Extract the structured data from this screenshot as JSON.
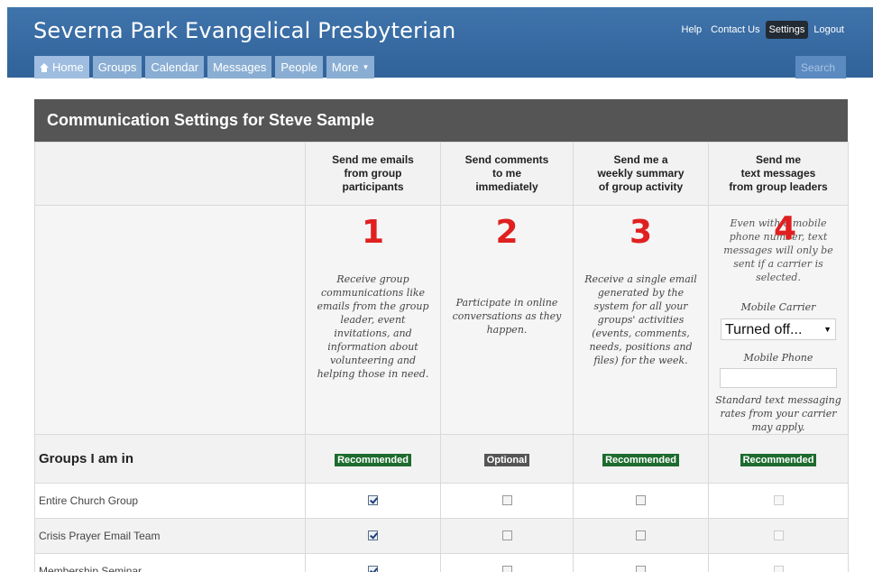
{
  "header": {
    "site_title": "Severna Park Evangelical Presbyterian",
    "utility_links": [
      "Help",
      "Contact Us",
      "Settings",
      "Logout"
    ],
    "active_utility": "Settings",
    "nav": [
      "Home",
      "Groups",
      "Calendar",
      "Messages",
      "People",
      "More"
    ],
    "search_placeholder": "Search"
  },
  "panel": {
    "title": "Communication Settings for Steve Sample",
    "columns": [
      {
        "header": [
          "Send me emails",
          "from group",
          "participants"
        ],
        "number": "1",
        "description": "Receive group communications like emails from the group leader, event invitations, and information about volunteering and helping those in need.",
        "badge": "Recommended"
      },
      {
        "header": [
          "Send comments",
          "to me",
          "immediately"
        ],
        "number": "2",
        "description": "Participate in online conversations as they happen.",
        "badge": "Optional"
      },
      {
        "header": [
          "Send me a",
          "weekly summary",
          "of group activity"
        ],
        "number": "3",
        "description": "Receive a single email generated by the system for all your groups' activities (events, comments, needs, positions and files) for the week.",
        "badge": "Recommended"
      },
      {
        "header": [
          "Send me",
          "text messages",
          "from group leaders"
        ],
        "number": "4",
        "intro": "Even with a mobile phone number, text messages will only be sent if a carrier is selected.",
        "carrier_label": "Mobile Carrier",
        "carrier_value": "Turned off...",
        "phone_label": "Mobile Phone",
        "phone_value": "",
        "rates_note": "Standard text messaging rates from your carrier may apply.",
        "badge": "Recommended"
      }
    ],
    "groups_label": "Groups I am in",
    "groups": [
      {
        "name": "Entire Church Group",
        "checks": [
          true,
          false,
          false,
          false
        ]
      },
      {
        "name": "Crisis Prayer Email Team",
        "checks": [
          true,
          false,
          false,
          false
        ]
      },
      {
        "name": "Membership Seminar",
        "checks": [
          true,
          false,
          false,
          false
        ]
      }
    ]
  }
}
